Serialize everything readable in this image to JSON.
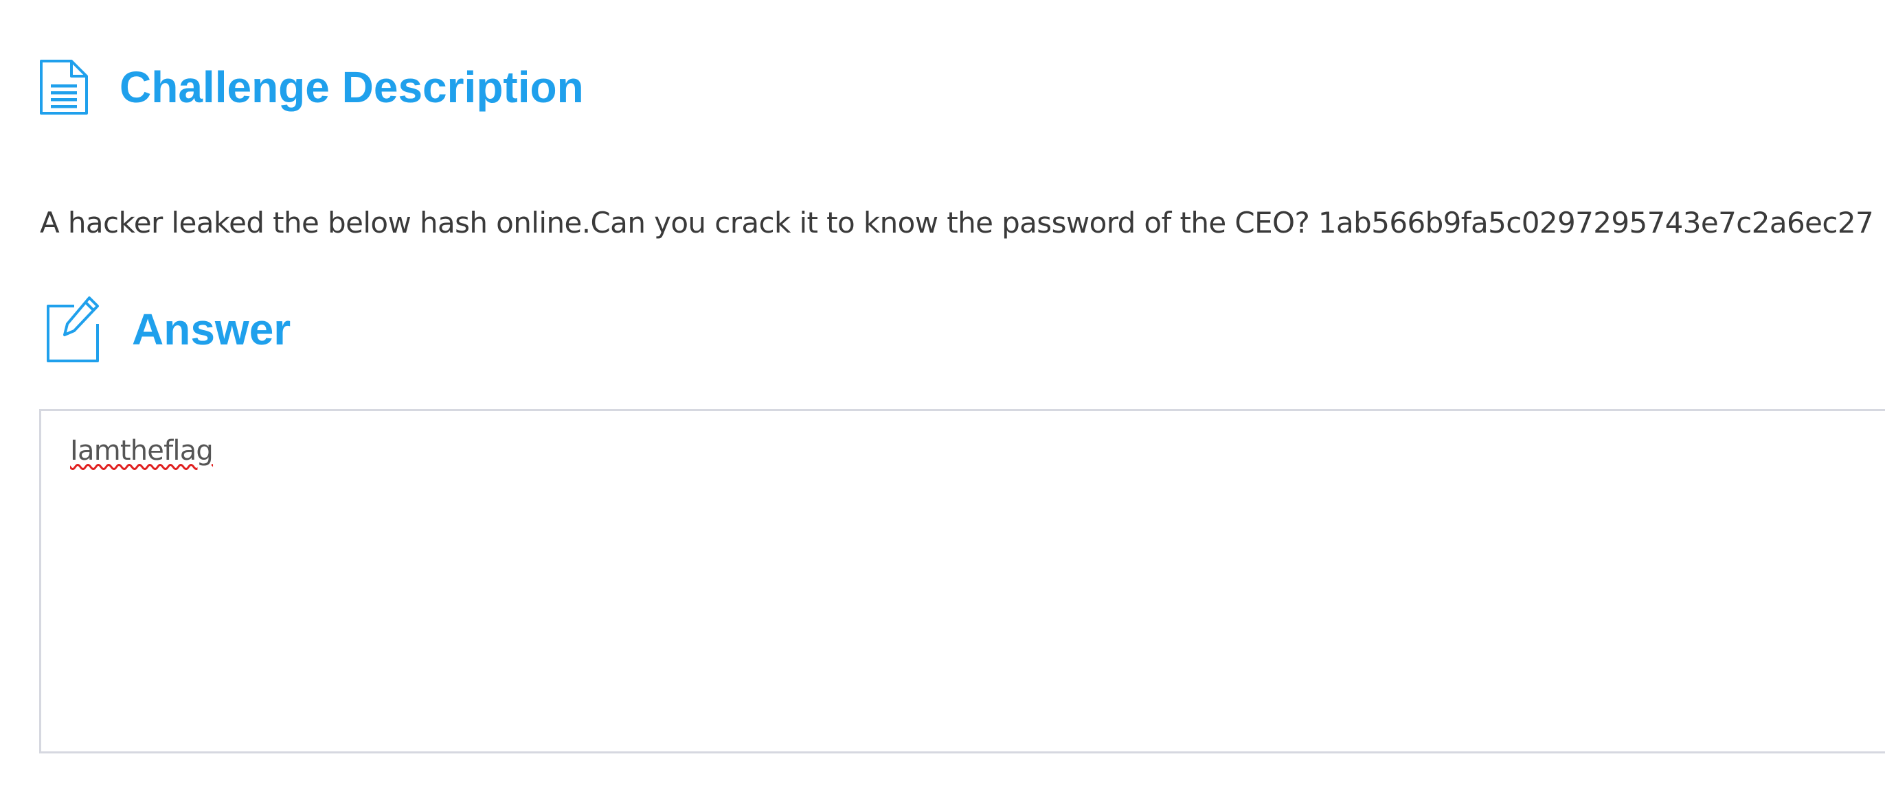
{
  "challenge": {
    "title": "Challenge Description",
    "icon": "document-icon",
    "description": "A hacker leaked the below hash online.Can you crack it to know the password of the CEO? 1ab566b9fa5c0297295743e7c2a6ec27"
  },
  "answer": {
    "title": "Answer",
    "icon": "edit-icon",
    "value": "Iamtheflag"
  },
  "colors": {
    "accent": "#1fa0ec",
    "text": "#3a3a3a",
    "border": "#d6d8e0",
    "spellcheck": "#e02020"
  }
}
